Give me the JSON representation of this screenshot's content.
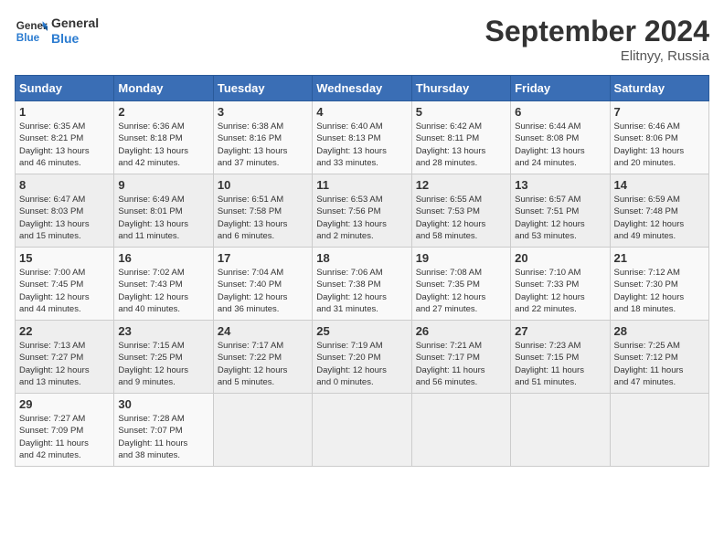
{
  "logo": {
    "line1": "General",
    "line2": "Blue"
  },
  "title": "September 2024",
  "subtitle": "Elitnyy, Russia",
  "days_of_week": [
    "Sunday",
    "Monday",
    "Tuesday",
    "Wednesday",
    "Thursday",
    "Friday",
    "Saturday"
  ],
  "weeks": [
    [
      {
        "day": "1",
        "info": "Sunrise: 6:35 AM\nSunset: 8:21 PM\nDaylight: 13 hours\nand 46 minutes."
      },
      {
        "day": "2",
        "info": "Sunrise: 6:36 AM\nSunset: 8:18 PM\nDaylight: 13 hours\nand 42 minutes."
      },
      {
        "day": "3",
        "info": "Sunrise: 6:38 AM\nSunset: 8:16 PM\nDaylight: 13 hours\nand 37 minutes."
      },
      {
        "day": "4",
        "info": "Sunrise: 6:40 AM\nSunset: 8:13 PM\nDaylight: 13 hours\nand 33 minutes."
      },
      {
        "day": "5",
        "info": "Sunrise: 6:42 AM\nSunset: 8:11 PM\nDaylight: 13 hours\nand 28 minutes."
      },
      {
        "day": "6",
        "info": "Sunrise: 6:44 AM\nSunset: 8:08 PM\nDaylight: 13 hours\nand 24 minutes."
      },
      {
        "day": "7",
        "info": "Sunrise: 6:46 AM\nSunset: 8:06 PM\nDaylight: 13 hours\nand 20 minutes."
      }
    ],
    [
      {
        "day": "8",
        "info": "Sunrise: 6:47 AM\nSunset: 8:03 PM\nDaylight: 13 hours\nand 15 minutes."
      },
      {
        "day": "9",
        "info": "Sunrise: 6:49 AM\nSunset: 8:01 PM\nDaylight: 13 hours\nand 11 minutes."
      },
      {
        "day": "10",
        "info": "Sunrise: 6:51 AM\nSunset: 7:58 PM\nDaylight: 13 hours\nand 6 minutes."
      },
      {
        "day": "11",
        "info": "Sunrise: 6:53 AM\nSunset: 7:56 PM\nDaylight: 13 hours\nand 2 minutes."
      },
      {
        "day": "12",
        "info": "Sunrise: 6:55 AM\nSunset: 7:53 PM\nDaylight: 12 hours\nand 58 minutes."
      },
      {
        "day": "13",
        "info": "Sunrise: 6:57 AM\nSunset: 7:51 PM\nDaylight: 12 hours\nand 53 minutes."
      },
      {
        "day": "14",
        "info": "Sunrise: 6:59 AM\nSunset: 7:48 PM\nDaylight: 12 hours\nand 49 minutes."
      }
    ],
    [
      {
        "day": "15",
        "info": "Sunrise: 7:00 AM\nSunset: 7:45 PM\nDaylight: 12 hours\nand 44 minutes."
      },
      {
        "day": "16",
        "info": "Sunrise: 7:02 AM\nSunset: 7:43 PM\nDaylight: 12 hours\nand 40 minutes."
      },
      {
        "day": "17",
        "info": "Sunrise: 7:04 AM\nSunset: 7:40 PM\nDaylight: 12 hours\nand 36 minutes."
      },
      {
        "day": "18",
        "info": "Sunrise: 7:06 AM\nSunset: 7:38 PM\nDaylight: 12 hours\nand 31 minutes."
      },
      {
        "day": "19",
        "info": "Sunrise: 7:08 AM\nSunset: 7:35 PM\nDaylight: 12 hours\nand 27 minutes."
      },
      {
        "day": "20",
        "info": "Sunrise: 7:10 AM\nSunset: 7:33 PM\nDaylight: 12 hours\nand 22 minutes."
      },
      {
        "day": "21",
        "info": "Sunrise: 7:12 AM\nSunset: 7:30 PM\nDaylight: 12 hours\nand 18 minutes."
      }
    ],
    [
      {
        "day": "22",
        "info": "Sunrise: 7:13 AM\nSunset: 7:27 PM\nDaylight: 12 hours\nand 13 minutes."
      },
      {
        "day": "23",
        "info": "Sunrise: 7:15 AM\nSunset: 7:25 PM\nDaylight: 12 hours\nand 9 minutes."
      },
      {
        "day": "24",
        "info": "Sunrise: 7:17 AM\nSunset: 7:22 PM\nDaylight: 12 hours\nand 5 minutes."
      },
      {
        "day": "25",
        "info": "Sunrise: 7:19 AM\nSunset: 7:20 PM\nDaylight: 12 hours\nand 0 minutes."
      },
      {
        "day": "26",
        "info": "Sunrise: 7:21 AM\nSunset: 7:17 PM\nDaylight: 11 hours\nand 56 minutes."
      },
      {
        "day": "27",
        "info": "Sunrise: 7:23 AM\nSunset: 7:15 PM\nDaylight: 11 hours\nand 51 minutes."
      },
      {
        "day": "28",
        "info": "Sunrise: 7:25 AM\nSunset: 7:12 PM\nDaylight: 11 hours\nand 47 minutes."
      }
    ],
    [
      {
        "day": "29",
        "info": "Sunrise: 7:27 AM\nSunset: 7:09 PM\nDaylight: 11 hours\nand 42 minutes."
      },
      {
        "day": "30",
        "info": "Sunrise: 7:28 AM\nSunset: 7:07 PM\nDaylight: 11 hours\nand 38 minutes."
      },
      {
        "day": "",
        "info": ""
      },
      {
        "day": "",
        "info": ""
      },
      {
        "day": "",
        "info": ""
      },
      {
        "day": "",
        "info": ""
      },
      {
        "day": "",
        "info": ""
      }
    ]
  ]
}
